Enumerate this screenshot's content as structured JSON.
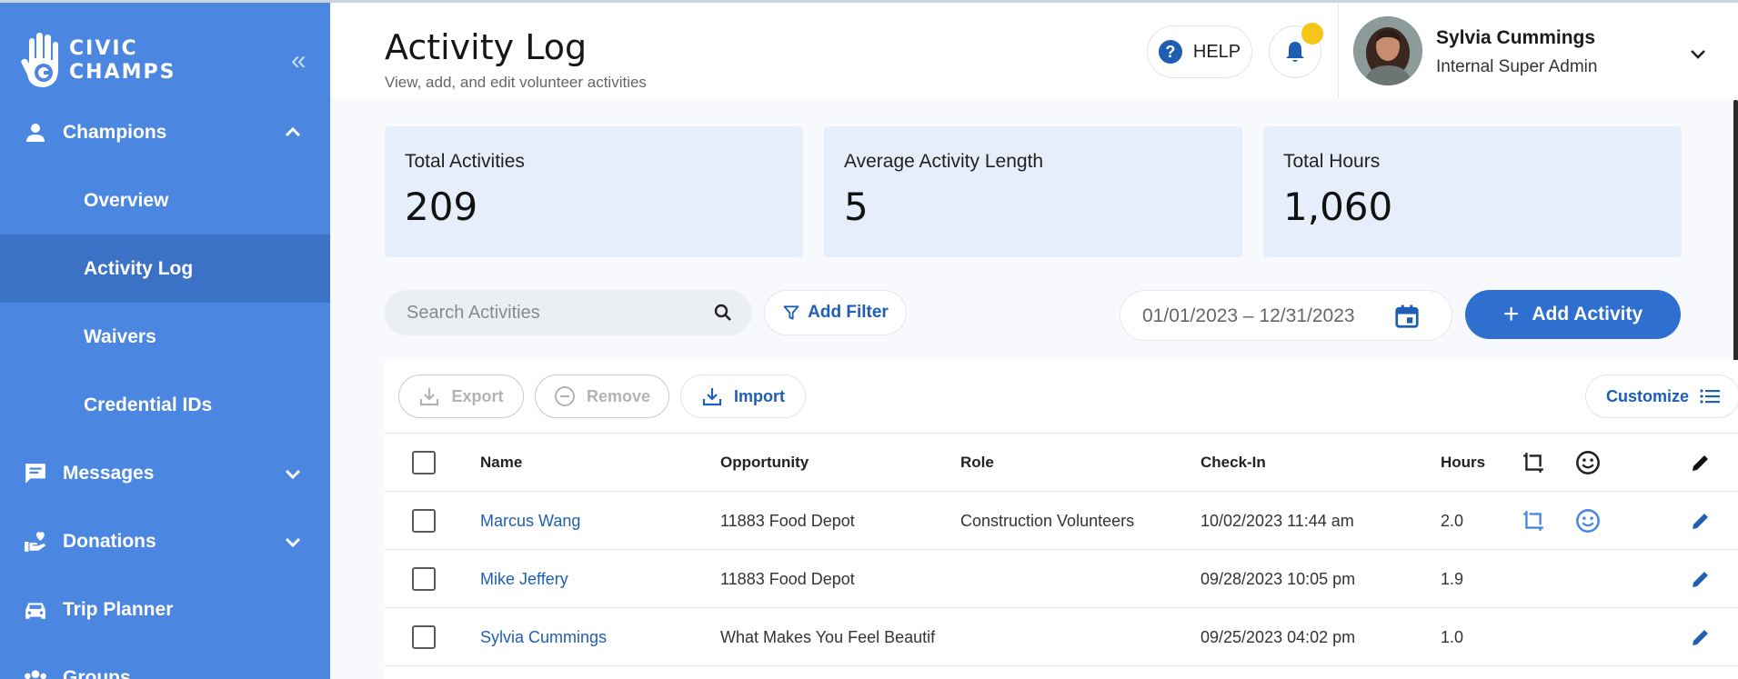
{
  "sidebar": {
    "logo_line1": "CIVIC",
    "logo_line2": "CHAMPS",
    "collapse_icon": "double-chevron-left-icon",
    "sections": [
      {
        "label": "Champions",
        "icon": "person-icon",
        "expanded": true
      },
      {
        "label": "Messages",
        "icon": "chat-icon",
        "expanded": false
      },
      {
        "label": "Donations",
        "icon": "donation-hand-icon",
        "expanded": false
      },
      {
        "label": "Trip Planner",
        "icon": "car-icon"
      },
      {
        "label": "Groups",
        "icon": "groups-icon"
      }
    ],
    "sub_items": [
      {
        "label": "Overview"
      },
      {
        "label": "Activity Log",
        "active": true
      },
      {
        "label": "Waivers"
      },
      {
        "label": "Credential IDs"
      }
    ]
  },
  "header": {
    "title": "Activity Log",
    "subtitle": "View, add, and edit volunteer activities",
    "help_label": "HELP",
    "user_name": "Sylvia Cummings",
    "user_role": "Internal Super Admin"
  },
  "stats": [
    {
      "title": "Total Activities",
      "value": "209"
    },
    {
      "title": "Average Activity Length",
      "value": "5"
    },
    {
      "title": "Total Hours",
      "value": "1,060"
    }
  ],
  "toolbar": {
    "search_placeholder": "Search Activities",
    "add_filter_label": "Add Filter",
    "date_range": "01/01/2023 – 12/31/2023",
    "add_activity_label": "Add Activity"
  },
  "table_toolbar": {
    "export_label": "Export",
    "remove_label": "Remove",
    "import_label": "Import",
    "customize_label": "Customize"
  },
  "table": {
    "columns": [
      "Name",
      "Opportunity",
      "Role",
      "Check-In",
      "Hours"
    ],
    "rows": [
      {
        "name": "Marcus Wang",
        "opportunity": "11883 Food Depot",
        "role": "Construction Volunteers",
        "checkin": "10/02/2023 11:44 am",
        "hours": "2.0",
        "has_icons": true
      },
      {
        "name": "Mike Jeffery",
        "opportunity": "11883 Food Depot",
        "role": "",
        "checkin": "09/28/2023 10:05 pm",
        "hours": "1.9",
        "has_icons": false
      },
      {
        "name": "Sylvia Cummings",
        "opportunity": "What Makes You Feel Beautif",
        "role": "",
        "checkin": "09/25/2023 04:02 pm",
        "hours": "1.0",
        "has_icons": false
      }
    ]
  },
  "colors": {
    "sidebar": "#4b87e0",
    "sidebar_active": "#3b72c6",
    "primary": "#2e6fd0",
    "link": "#1e5fb4",
    "stat_bg": "#e6eefb",
    "notification_dot": "#f5c518"
  }
}
